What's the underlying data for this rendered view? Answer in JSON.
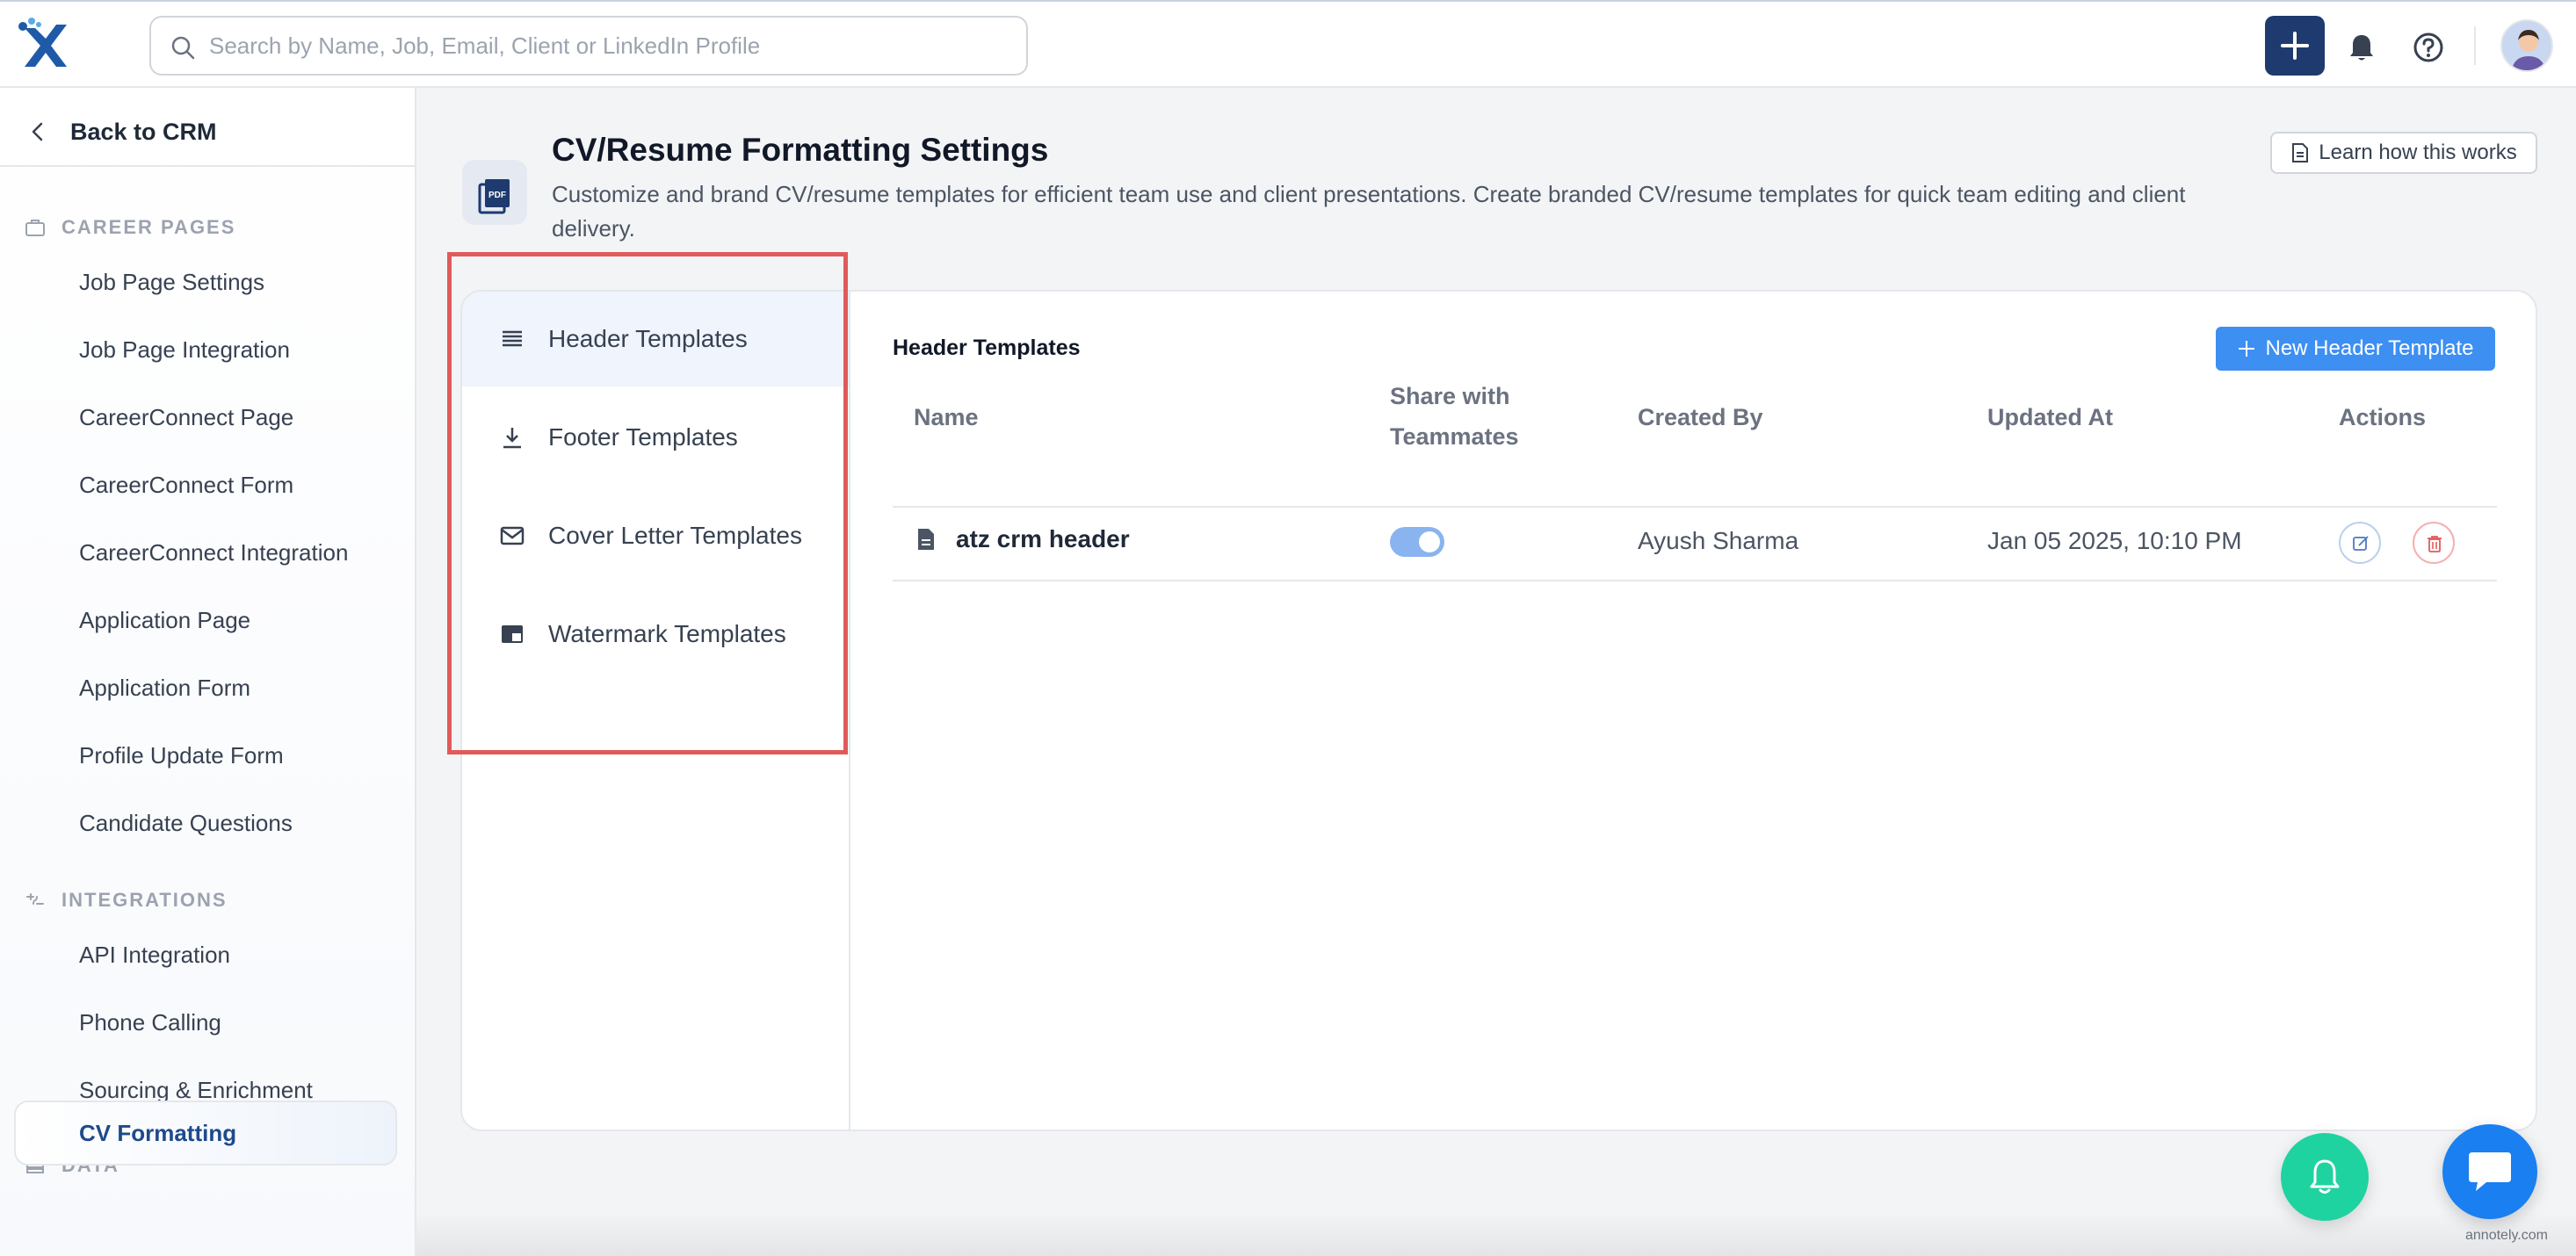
{
  "topbar": {
    "search_placeholder": "Search by Name, Job, Email, Client or LinkedIn Profile",
    "icons": [
      "search-icon",
      "plus-icon",
      "bell-icon",
      "help-icon",
      "avatar"
    ],
    "accent_color": "#1e3a6e"
  },
  "sidebar": {
    "back_label": "Back to CRM",
    "sections": [
      {
        "title": "CAREER PAGES",
        "icon": "briefcase-icon",
        "items": [
          "Job Page Settings",
          "Job Page Integration",
          "CareerConnect Page",
          "CareerConnect Form",
          "CareerConnect Integration",
          "Application Page",
          "Application Form",
          "Profile Update Form",
          "Candidate Questions"
        ]
      },
      {
        "title": "INTEGRATIONS",
        "icon": "integrations-icon",
        "items": [
          "API Integration",
          "Phone Calling",
          "Sourcing & Enrichment"
        ]
      },
      {
        "title": "DATA",
        "icon": "list-icon",
        "items": [
          "CV Formatting"
        ]
      }
    ],
    "active_item": "CV Formatting"
  },
  "header": {
    "icon_label": "PDF",
    "title": "CV/Resume Formatting Settings",
    "subtitle": "Customize and brand CV/resume templates for efficient team use and client presentations. Create branded CV/resume templates for quick team editing and client delivery.",
    "learn_label": "Learn how this works"
  },
  "tabs": [
    {
      "label": "Header Templates",
      "icon": "lines-icon",
      "active": true
    },
    {
      "label": "Footer Templates",
      "icon": "download-icon",
      "active": false
    },
    {
      "label": "Cover Letter Templates",
      "icon": "mail-icon",
      "active": false
    },
    {
      "label": "Watermark Templates",
      "icon": "watermark-icon",
      "active": false
    }
  ],
  "panel": {
    "title": "Header Templates",
    "new_button": "New Header Template",
    "columns": [
      "Name",
      "Share with Teammates",
      "Created By",
      "Updated At",
      "Actions"
    ],
    "rows": [
      {
        "name": "atz crm header",
        "shared": true,
        "created_by": "Ayush Sharma",
        "updated_at": "Jan 05 2025, 10:10 PM"
      }
    ]
  },
  "footer": {
    "brand_note": "annotely.com"
  },
  "colors": {
    "primary_button": "#3d8ff2",
    "highlight_box": "#e15a5a",
    "fab_bell": "#1fd3a0",
    "fab_chat": "#1a7ff0"
  }
}
